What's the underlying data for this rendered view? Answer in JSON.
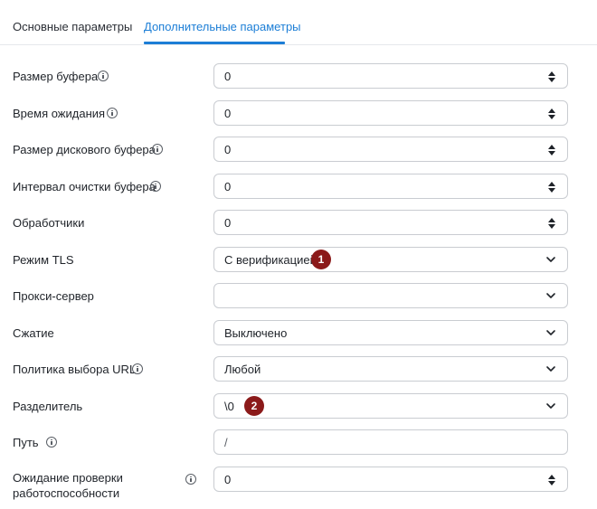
{
  "tabs": [
    {
      "label": "Основные параметры",
      "active": false
    },
    {
      "label": "Дополнительные параметры",
      "active": true
    }
  ],
  "accent_color": "#1c7ed6",
  "badge_color": "#8b1a1a",
  "fields": [
    {
      "label": "Размер буфера",
      "info": true,
      "type": "number",
      "value": "0"
    },
    {
      "label": "Время ожидания",
      "info": true,
      "type": "number",
      "value": "0"
    },
    {
      "label": "Размер дискового буфера",
      "info": true,
      "type": "number",
      "value": "0"
    },
    {
      "label": "Интервал очистки буфера",
      "info": true,
      "type": "number",
      "value": "0"
    },
    {
      "label": "Обработчики",
      "info": false,
      "type": "number",
      "value": "0"
    },
    {
      "label": "Режим TLS",
      "info": false,
      "type": "select",
      "value": "С верификацией",
      "badge": "1"
    },
    {
      "label": "Прокси-сервер",
      "info": false,
      "type": "select",
      "value": ""
    },
    {
      "label": "Сжатие",
      "info": false,
      "type": "select",
      "value": "Выключено"
    },
    {
      "label": "Политика выбора URL",
      "info": true,
      "type": "select",
      "value": "Любой"
    },
    {
      "label": "Разделитель",
      "info": false,
      "type": "select",
      "value": "\\0",
      "badge": "2"
    },
    {
      "label": "Путь",
      "info": true,
      "type": "text",
      "value": "/"
    },
    {
      "label": "Ожидание проверки работоспособности",
      "info": true,
      "type": "number",
      "value": "0"
    }
  ]
}
